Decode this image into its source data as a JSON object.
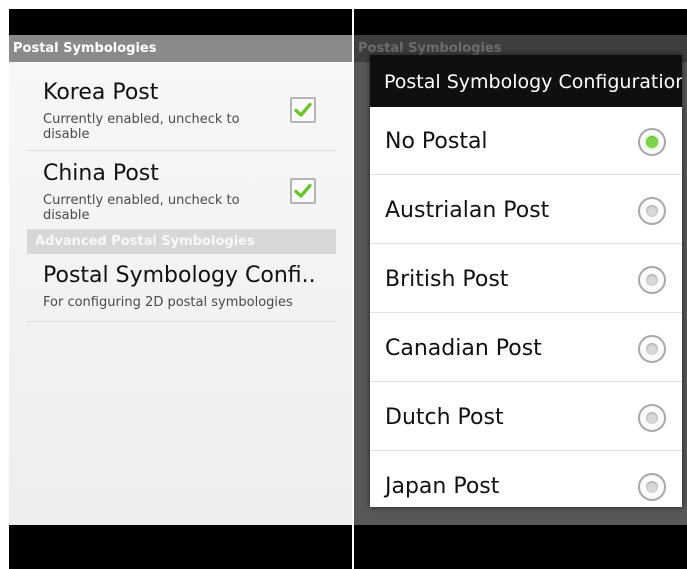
{
  "left_screen": {
    "title": "Postal Symbologies",
    "preferences": [
      {
        "title": "Korea Post",
        "summary": "Currently enabled, uncheck to disable",
        "checked": true
      },
      {
        "title": "China Post",
        "summary": "Currently enabled, uncheck to disable",
        "checked": true
      }
    ],
    "category": "Advanced Postal Symbologies",
    "config_item": {
      "title": "Postal Symbology Confi..",
      "summary": "For configuring 2D postal symbologies"
    }
  },
  "right_screen": {
    "background_title": "Postal Symbologies",
    "dialog": {
      "title": "Postal Symbology Configuration",
      "options": [
        {
          "label": "No Postal",
          "selected": true
        },
        {
          "label": "Austrialan Post",
          "selected": false
        },
        {
          "label": "British Post",
          "selected": false
        },
        {
          "label": "Canadian Post",
          "selected": false
        },
        {
          "label": "Dutch Post",
          "selected": false
        },
        {
          "label": "Japan Post",
          "selected": false
        }
      ]
    }
  },
  "colors": {
    "checkmark": "#6cc42c",
    "radio_selected": "#7fd34a",
    "title_bar": "#8a8a8a",
    "dialog_header": "#0f0f0f"
  },
  "icons": {
    "checkbox": "checkmark-icon",
    "radio": "radio-button-icon"
  }
}
